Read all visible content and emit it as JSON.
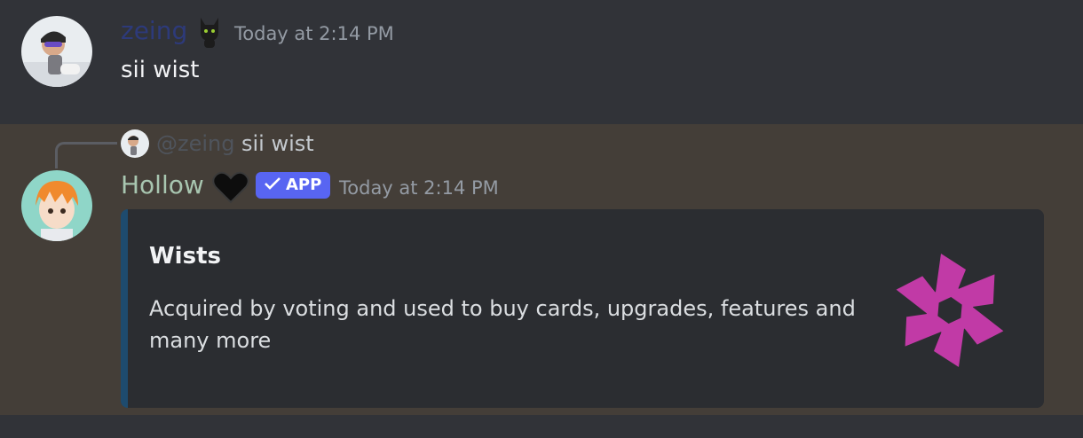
{
  "message1": {
    "username": "zeing",
    "username_color": "#2d3a7a",
    "role_icon": "black-cat-icon",
    "timestamp": "Today at 2:14 PM",
    "content": "sii wist"
  },
  "message2": {
    "reply": {
      "username": "@zeing",
      "content": "sii wist"
    },
    "username": "Hollow",
    "username_color": "#a8c6b0",
    "role_icon": "black-heart-icon",
    "badge": "APP",
    "badge_color": "#5865f2",
    "timestamp": "Today at 2:14 PM",
    "embed": {
      "title": "Wists",
      "description": "Acquired by voting and used to buy cards, upgrades, features and many more",
      "accent_color": "#1e4b6e",
      "thumbnail_icon": "pinwheel-star-icon",
      "thumbnail_color": "#c13aa6"
    }
  }
}
